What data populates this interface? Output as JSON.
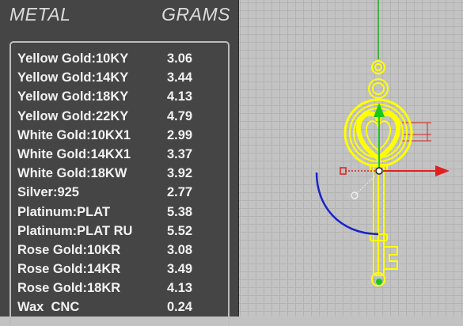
{
  "header": {
    "metal_label": "METAL",
    "grams_label": "GRAMS"
  },
  "rows": [
    {
      "metal": "Yellow Gold:10KY",
      "grams": "3.06"
    },
    {
      "metal": "Yellow Gold:14KY",
      "grams": "3.44"
    },
    {
      "metal": "Yellow Gold:18KY",
      "grams": "4.13"
    },
    {
      "metal": "Yellow Gold:22KY",
      "grams": "4.79"
    },
    {
      "metal": "White Gold:10KX1",
      "grams": "2.99"
    },
    {
      "metal": "White Gold:14KX1",
      "grams": "3.37"
    },
    {
      "metal": "White Gold:18KW",
      "grams": "3.92"
    },
    {
      "metal": "Silver:925",
      "grams": "2.77"
    },
    {
      "metal": "Platinum:PLAT",
      "grams": "5.38"
    },
    {
      "metal": "Platinum:PLAT RU",
      "grams": "5.52"
    },
    {
      "metal": "Rose Gold:10KR",
      "grams": "3.08"
    },
    {
      "metal": "Rose Gold:14KR",
      "grams": "3.49"
    },
    {
      "metal": "Rose Gold:18KR",
      "grams": "4.13"
    },
    {
      "metal": "Wax  CNC",
      "grams": "0.24"
    }
  ],
  "colors": {
    "panel_bg": "#454545",
    "model_highlight": "#ffff00",
    "x_axis": "#e02020",
    "y_axis": "#20c020",
    "rotation_arc": "#1a22c8"
  },
  "icons": [
    "key-pendant-model",
    "gumball-move-arrow-x",
    "gumball-move-arrow-y",
    "gumball-rotate-arc"
  ]
}
